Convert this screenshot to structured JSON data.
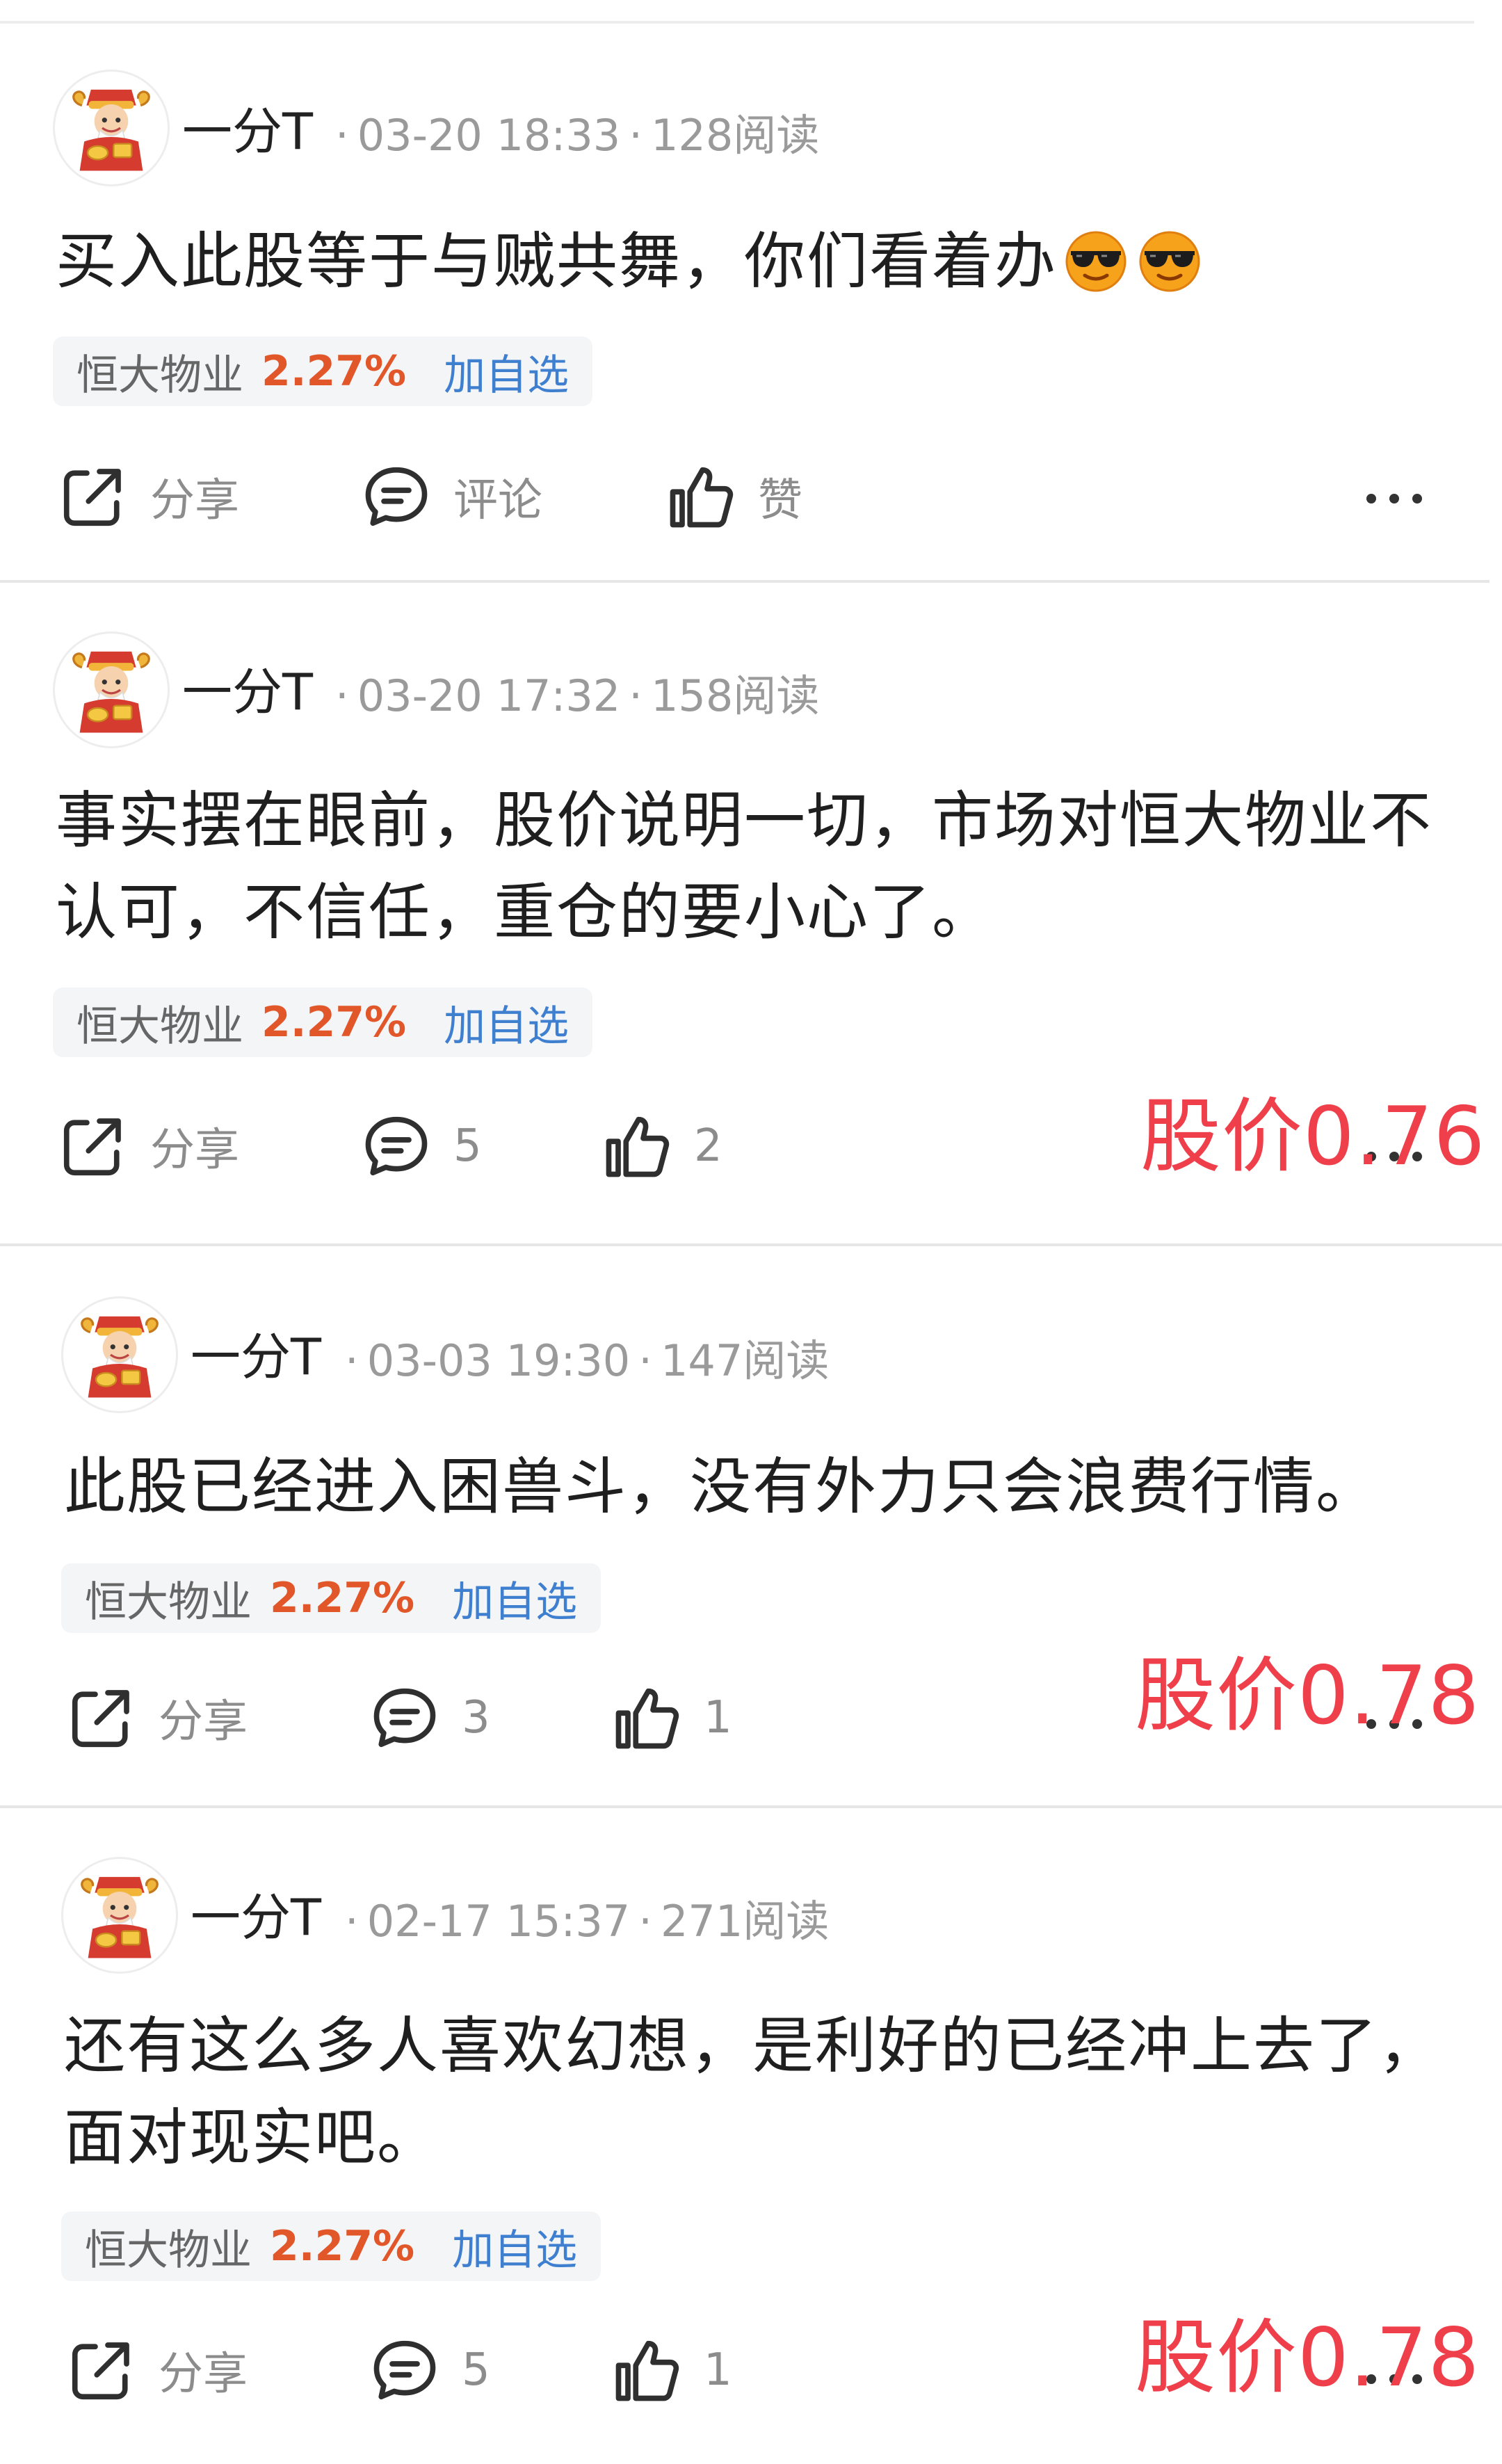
{
  "posts": [
    {
      "author": "一分T",
      "date": "03-20 18:33",
      "views": "128阅读",
      "content": "买入此股等于与贼共舞，你们看着办",
      "stock": {
        "name": "恒大物业",
        "change": "2.27%",
        "add": "加自选"
      },
      "actions": {
        "share": "分享",
        "comment": "评论",
        "like": "赞"
      },
      "price_note": ""
    },
    {
      "author": "一分T",
      "date": "03-20 17:32",
      "views": "158阅读",
      "content": "事实摆在眼前，股价说明一切，市场对恒大物业不认可，不信任，重仓的要小心了。",
      "stock": {
        "name": "恒大物业",
        "change": "2.27%",
        "add": "加自选"
      },
      "actions": {
        "share": "分享",
        "comment": "5",
        "like": "2"
      },
      "price_note": "股价0.76"
    },
    {
      "author": "一分T",
      "date": "03-03 19:30",
      "views": "147阅读",
      "content": "此股已经进入困兽斗，没有外力只会浪费行情。",
      "stock": {
        "name": "恒大物业",
        "change": "2.27%",
        "add": "加自选"
      },
      "actions": {
        "share": "分享",
        "comment": "3",
        "like": "1"
      },
      "price_note": "股价0.78"
    },
    {
      "author": "一分T",
      "date": "02-17 15:37",
      "views": "271阅读",
      "content": "还有这么多人喜欢幻想，是利好的已经冲上去了，面对现实吧。",
      "stock": {
        "name": "恒大物业",
        "change": "2.27%",
        "add": "加自选"
      },
      "actions": {
        "share": "分享",
        "comment": "5",
        "like": "1"
      },
      "price_note": "股价0.78"
    }
  ],
  "colors": {
    "stock_change": "#e2572a",
    "add_watch": "#3f7fd0",
    "price_note": "#ef3f4a",
    "meta_text": "#9a9a9a",
    "tag_bg": "#f4f5f7"
  },
  "icons": [
    "avatar-caishen-icon",
    "sunglasses-emoji-icon",
    "share-icon",
    "comment-icon",
    "thumbs-up-icon",
    "more-dots-icon"
  ]
}
